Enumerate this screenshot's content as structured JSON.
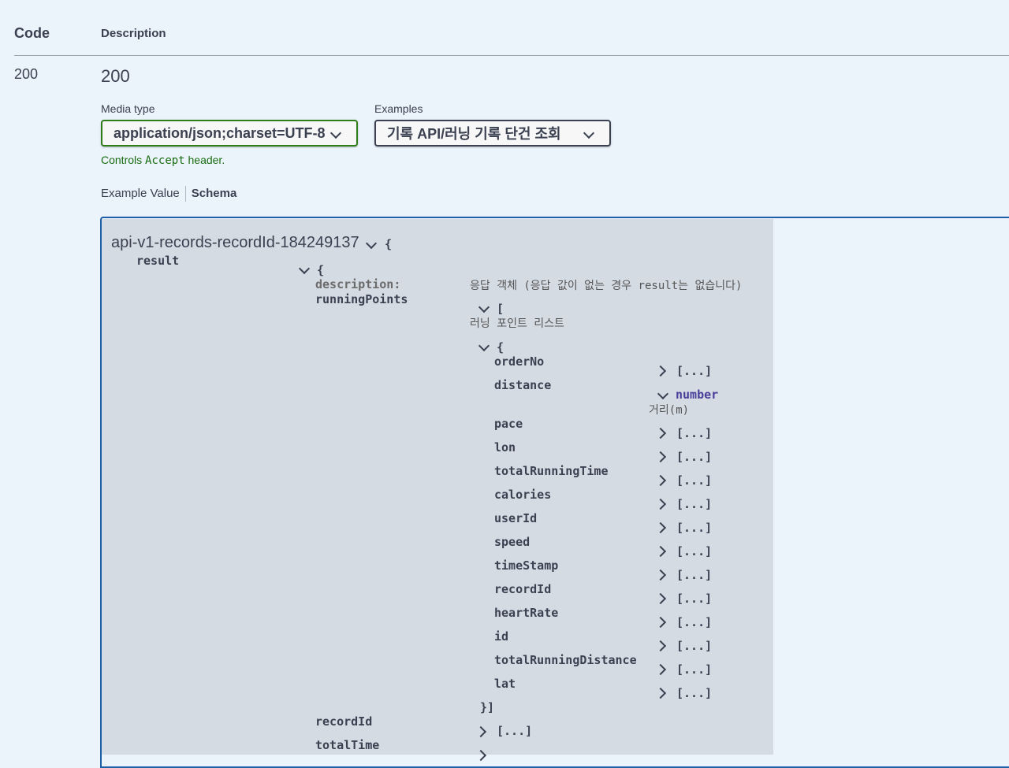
{
  "table": {
    "code_header": "Code",
    "description_header": "Description"
  },
  "response": {
    "code": "200",
    "description": "200"
  },
  "media_type": {
    "label": "Media type",
    "value": "application/json;charset=UTF-8",
    "note_prefix": "Controls",
    "note_code": "Accept",
    "note_suffix": "header."
  },
  "examples": {
    "label": "Examples",
    "value": "기록 API/러닝 기록 단건 조회"
  },
  "tabs": {
    "example_value": "Example Value",
    "schema": "Schema"
  },
  "model": {
    "title": "api-v1-records-recordId-184249137",
    "open_brace": "{",
    "result_key": "result",
    "result_brace": "{",
    "description_key": "description:",
    "description_value": "응답 객체 (응답 값이 없는 경우 result는 없습니다)",
    "running_points_key": "runningPoints",
    "running_points_bracket": "[",
    "running_points_desc": "러닝 포인트 리스트",
    "item_brace": "{",
    "item_close": "}]",
    "distance_type": "number",
    "distance_desc": "거리(m)",
    "collapsed": "[...]",
    "fields": [
      "orderNo",
      "distance",
      "pace",
      "lon",
      "totalRunningTime",
      "calories",
      "userId",
      "speed",
      "timeStamp",
      "recordId",
      "heartRate",
      "id",
      "totalRunningDistance",
      "lat"
    ],
    "outer_fields": [
      "recordId",
      "totalTime"
    ]
  }
}
